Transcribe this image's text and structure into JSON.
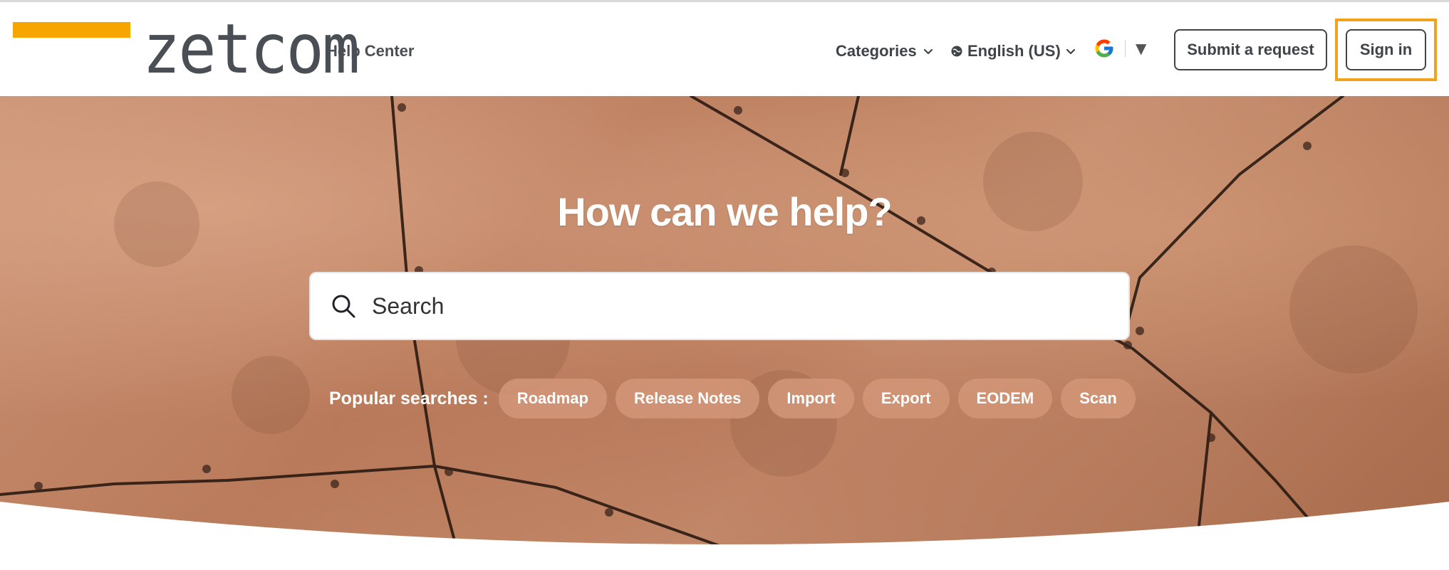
{
  "header": {
    "logo_text": "zetcom",
    "help_center": "Help Center",
    "nav": {
      "categories": "Categories",
      "language": "English (US)"
    },
    "buttons": {
      "submit_request": "Submit a request",
      "sign_in": "Sign in"
    },
    "icons": {
      "translate": "google-icon",
      "dropdown": "caret-down-icon"
    },
    "brand_color": "#f7a500",
    "focus_color": "#f2a21b"
  },
  "hero": {
    "title": "How can we help?",
    "search": {
      "placeholder": "Search",
      "icon": "search-icon"
    },
    "popular_label": "Popular searches :",
    "popular_searches": [
      "Roadmap",
      "Release Notes",
      "Import",
      "Export",
      "EODEM",
      "Scan"
    ]
  }
}
